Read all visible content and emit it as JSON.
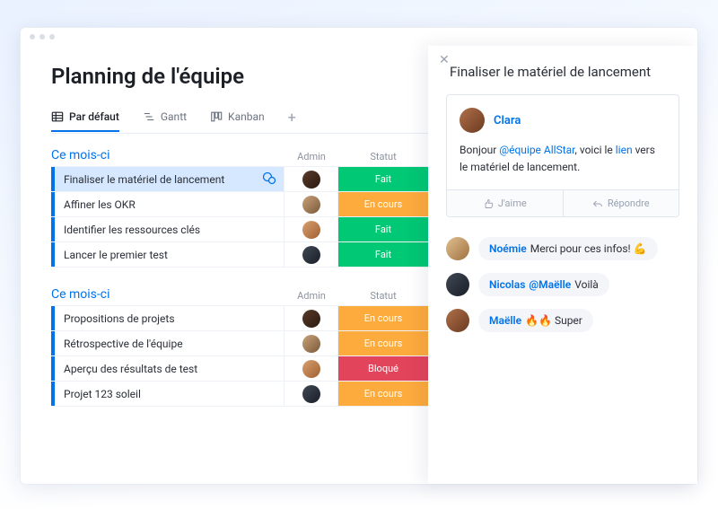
{
  "page": {
    "title": "Planning de l'équipe"
  },
  "tabs": [
    {
      "label": "Par défaut",
      "active": true
    },
    {
      "label": "Gantt",
      "active": false
    },
    {
      "label": "Kanban",
      "active": false
    }
  ],
  "columns": {
    "admin": "Admin",
    "status": "Statut"
  },
  "status_labels": {
    "done": "Fait",
    "prog": "En cours",
    "block": "Bloqué"
  },
  "groups": [
    {
      "title": "Ce mois-ci",
      "rows": [
        {
          "task": "Finaliser le matériel de lancement",
          "admin": "av-b",
          "status": "done",
          "selected": true,
          "chat": true
        },
        {
          "task": "Affiner les OKR",
          "admin": "av-a",
          "status": "prog"
        },
        {
          "task": "Identifier les ressources clés",
          "admin": "av-c",
          "status": "done"
        },
        {
          "task": "Lancer le premier test",
          "admin": "av-d",
          "status": "done"
        }
      ]
    },
    {
      "title": "Ce mois-ci",
      "rows": [
        {
          "task": "Propositions de projets",
          "admin": "av-b",
          "status": "prog"
        },
        {
          "task": "Rétrospective de l'équipe",
          "admin": "av-a",
          "status": "prog"
        },
        {
          "task": "Aperçu des résultats de test",
          "admin": "av-c",
          "status": "block"
        },
        {
          "task": "Projet 123 soleil",
          "admin": "av-d",
          "status": "prog"
        }
      ]
    }
  ],
  "panel": {
    "title": "Finaliser le matériel de lancement",
    "update": {
      "author": "Clara",
      "avatar": "av-f",
      "text_pre": "Bonjour ",
      "mention": "@équipe AllStar",
      "text_mid": ", voici le ",
      "link": "lien",
      "text_post": " vers le matériel de lancement."
    },
    "actions": {
      "like": "J'aime",
      "reply": "Répondre"
    },
    "replies": [
      {
        "avatar": "av-e",
        "name": "Noémie",
        "text": "Merci pour ces infos! 💪"
      },
      {
        "avatar": "av-d",
        "name": "Nicolas",
        "mention": "@Maëlle",
        "text": "Voilà"
      },
      {
        "avatar": "av-f",
        "name": "Maëlle",
        "text": "🔥🔥 Super"
      }
    ]
  }
}
